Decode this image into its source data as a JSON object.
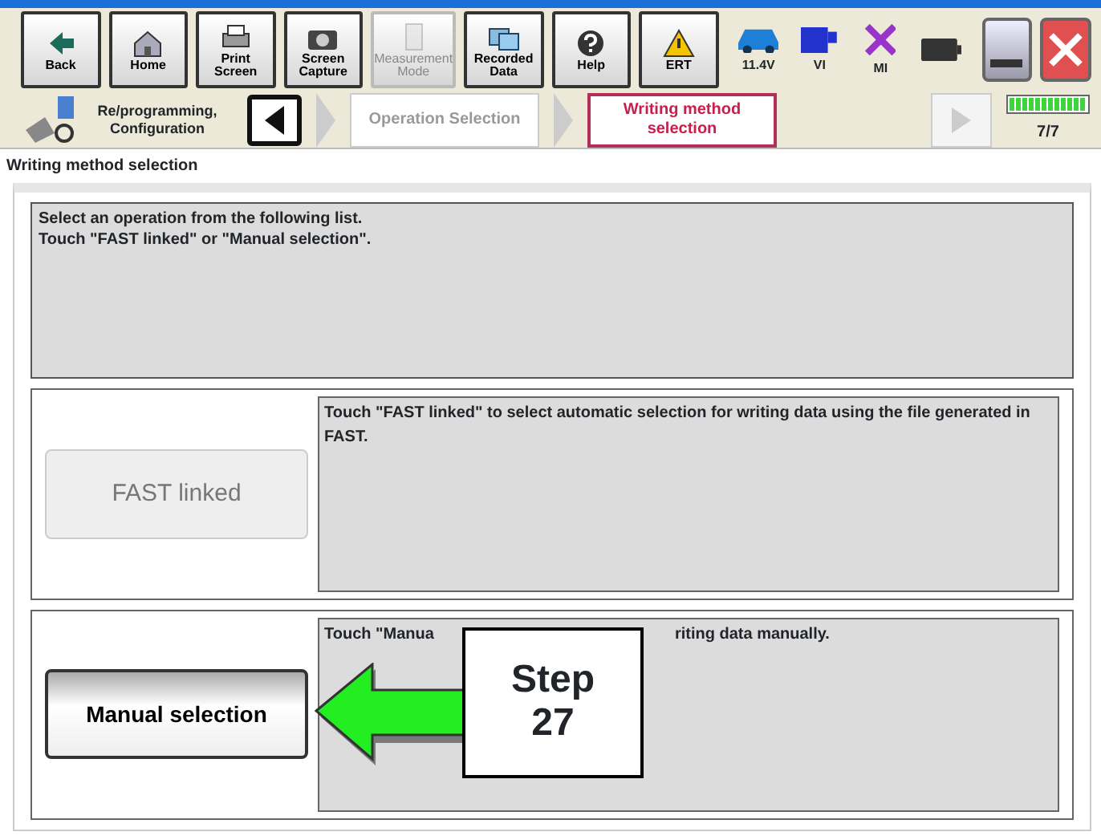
{
  "toolbar": {
    "buttons": [
      {
        "label": "Back",
        "kind": "back",
        "disabled": false
      },
      {
        "label": "Home",
        "kind": "home",
        "disabled": false
      },
      {
        "label": "Print Screen",
        "kind": "print",
        "disabled": false
      },
      {
        "label": "Screen Capture",
        "kind": "camera",
        "disabled": false
      },
      {
        "label": "Measurement Mode",
        "kind": "measure",
        "disabled": true
      },
      {
        "label": "Recorded Data",
        "kind": "data",
        "disabled": false
      },
      {
        "label": "Help",
        "kind": "help",
        "disabled": false
      },
      {
        "label": "ERT",
        "kind": "warning",
        "disabled": false
      }
    ],
    "status": [
      {
        "label": "11.4V",
        "kind": "car"
      },
      {
        "label": "VI",
        "kind": "vi"
      },
      {
        "label": "MI",
        "kind": "mi"
      },
      {
        "kind": "battery"
      }
    ]
  },
  "breadcrumb": {
    "section": "Re/programming, Configuration",
    "steps": [
      {
        "label": "Operation Selection",
        "selected": false
      },
      {
        "label": "Writing method selection",
        "selected": true
      }
    ],
    "progress": {
      "level": 1.0,
      "reading": "7/7"
    }
  },
  "page_title": "Writing method selection",
  "instructions": [
    "Select an operation from the following list.",
    "Touch \"FAST linked\" or \"Manual selection\"."
  ],
  "options": [
    {
      "label": "FAST linked",
      "disabled": true,
      "description": [
        "Touch \"FAST linked\" to select automatic selection for writing data using the file generated in FAST."
      ]
    },
    {
      "label": "Manual selection",
      "disabled": false,
      "description": [
        "Touch \"Manua",
        "riting data manually."
      ],
      "callout": "Step 27"
    }
  ]
}
